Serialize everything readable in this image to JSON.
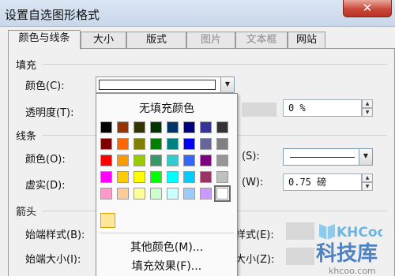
{
  "window": {
    "title": "设置自选图形格式",
    "close_glyph": "✕"
  },
  "tabs": [
    {
      "label": "颜色与线条",
      "active": true
    },
    {
      "label": "大小"
    },
    {
      "label": "版式"
    },
    {
      "label": "图片",
      "disabled": true
    },
    {
      "label": "文本框",
      "disabled": true
    },
    {
      "label": "网站"
    }
  ],
  "fill": {
    "section": "填充",
    "color_label": "颜色(C):",
    "transparency_label": "透明度(T):",
    "transparency_value": "0 %"
  },
  "line": {
    "section": "线条",
    "color_label": "颜色(O):",
    "style_label": "(S):",
    "dash_label": "虚实(D):",
    "weight_label": "(W):",
    "weight_value": "0.75 磅"
  },
  "arrows": {
    "section": "箭头",
    "begin_style_label": "始端样式(B):",
    "end_style_label": "样式(E):",
    "begin_size_label": "始端大小(I):",
    "end_size_label": "大小(Z):"
  },
  "color_popup": {
    "no_fill": "无填充颜色",
    "more_colors": "其他颜色(M)...",
    "fill_effects": "填充效果(F)...",
    "recent_color": "#ffe799",
    "palette": [
      [
        "#000000",
        "#993300",
        "#333300",
        "#003300",
        "#003366",
        "#000080",
        "#333399",
        "#333333"
      ],
      [
        "#800000",
        "#ff6600",
        "#808000",
        "#008000",
        "#008080",
        "#0000ff",
        "#666699",
        "#808080"
      ],
      [
        "#ff0000",
        "#ff9900",
        "#99cc00",
        "#339966",
        "#33cccc",
        "#3366ff",
        "#800080",
        "#969696"
      ],
      [
        "#ff00ff",
        "#ffcc00",
        "#ffff00",
        "#00ff00",
        "#00ffff",
        "#00ccff",
        "#993366",
        "#c0c0c0"
      ],
      [
        "#ff99cc",
        "#ffcc99",
        "#ffff99",
        "#ccffcc",
        "#ccffff",
        "#99ccff",
        "#cc99ff",
        "#ffffff"
      ]
    ]
  },
  "watermark": {
    "logo": "KHCoo",
    "name": "科技库",
    "url": "khcoo.com"
  }
}
